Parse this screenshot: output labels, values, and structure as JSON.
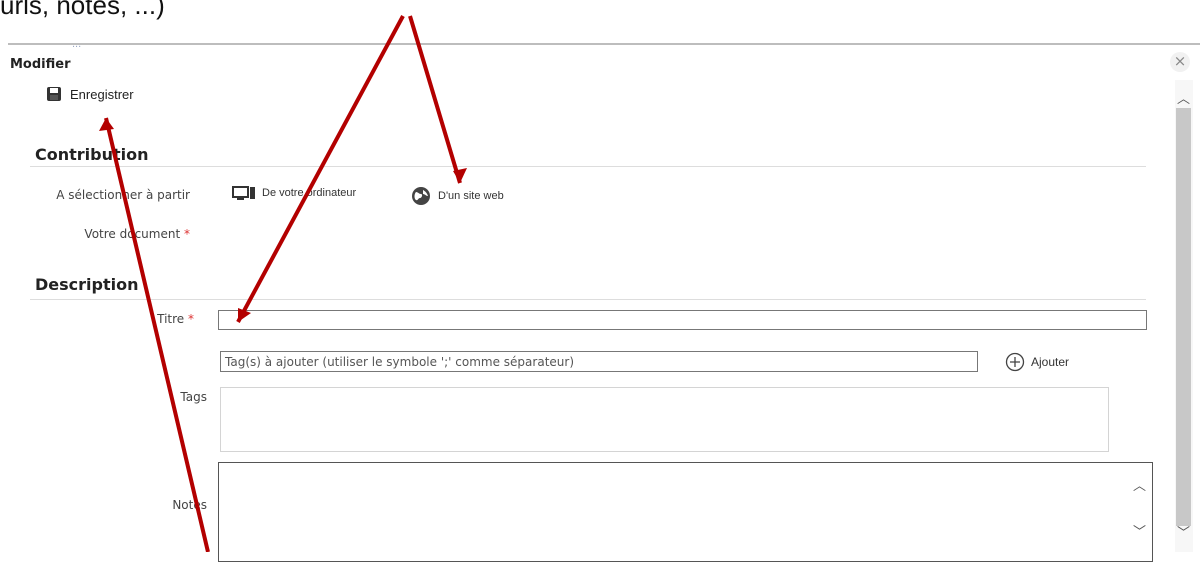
{
  "annotation": {
    "top_text": "urls, notes, ...)"
  },
  "background_text": "...",
  "modal": {
    "title": "Modifier",
    "close_icon": "×",
    "save_label": "Enregistrer"
  },
  "contribution": {
    "heading": "Contribution",
    "select_from_label": "A sélectionner à partir",
    "option_computer": "De votre ordinateur",
    "option_website": "D'un site web",
    "document_label": "Votre document",
    "required_mark": "*"
  },
  "description": {
    "heading": "Description",
    "title_label": "Titre",
    "required_mark": "*",
    "title_value": "",
    "tag_placeholder": "Tag(s) à ajouter (utiliser le symbole ';' comme séparateur)",
    "add_label": "Ajouter",
    "tags_label": "Tags",
    "notes_label": "Notes"
  },
  "colors": {
    "annotation_arrow": "#b30000"
  }
}
